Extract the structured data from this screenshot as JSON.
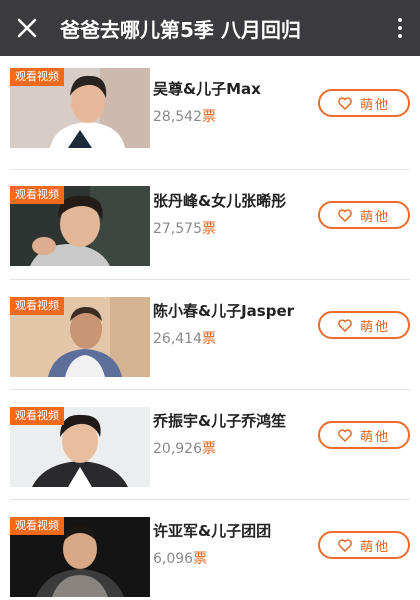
{
  "header": {
    "title": "爸爸去哪儿第5季 八月回归",
    "close_icon": "close-icon",
    "more_icon": "more-vertical-icon"
  },
  "colors": {
    "header_bg": "#3a3a3f",
    "accent": "#ef6b2b",
    "badge_bg": "#f06a1d"
  },
  "list": {
    "items": [
      {
        "badge": "观看视频",
        "name": "吴尊&儿子Max",
        "votes": "28,542",
        "unit": "票",
        "button": "萌他"
      },
      {
        "badge": "观看视频",
        "name": "张丹峰&女儿张晞彤",
        "votes": "27,575",
        "unit": "票",
        "button": "萌他"
      },
      {
        "badge": "观看视频",
        "name": "陈小春&儿子Jasper",
        "votes": "26,414",
        "unit": "票",
        "button": "萌他"
      },
      {
        "badge": "观看视频",
        "name": "乔振宇&儿子乔鸿笙",
        "votes": "20,926",
        "unit": "票",
        "button": "萌他"
      },
      {
        "badge": "观看视频",
        "name": "许亚军&儿子团团",
        "votes": "6,096",
        "unit": "票",
        "button": "萌他"
      }
    ]
  }
}
